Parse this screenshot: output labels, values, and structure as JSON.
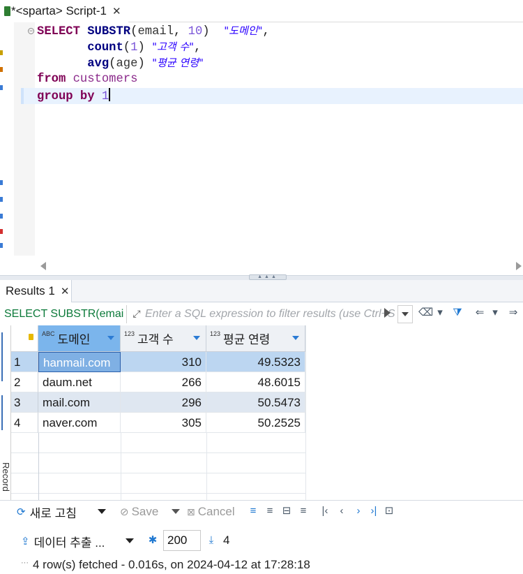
{
  "editor": {
    "tab_label": "*<sparta> Script-1",
    "tab_close": "✕",
    "sql": {
      "l1_kw": "SELECT",
      "l1_fn": "SUBSTR",
      "l1_open": "(",
      "l1_arg": "email",
      "l1_comma": ", ",
      "l1_num": "10",
      "l1_close": ")",
      "l1_alias": "\"도메인\"",
      "l1_end": ",",
      "l2_fn": "count",
      "l2_open": "(",
      "l2_num": "1",
      "l2_close": ")",
      "l2_alias": "\"고객 수\"",
      "l2_end": ",",
      "l3_fn": "avg",
      "l3_open": "(",
      "l3_arg": "age",
      "l3_close": ")",
      "l3_alias": "\"평균 연령\"",
      "l4_kw": "from",
      "l4_table": "customers",
      "l5_kw": "group by",
      "l5_num": "1"
    }
  },
  "results": {
    "tab_label": "Results 1",
    "tab_close": "✕",
    "filter_query": "SELECT SUBSTR(emai",
    "filter_placeholder": "Enter a SQL expression to filter results (use Ctrl+Space)",
    "columns": [
      {
        "type": "ABC",
        "name": "도메인"
      },
      {
        "type": "123",
        "name": "고객 수"
      },
      {
        "type": "123",
        "name": "평균 연령"
      }
    ],
    "rows": [
      {
        "num": "1",
        "domain": "hanmail.com",
        "count": "310",
        "avg": "49.5323"
      },
      {
        "num": "2",
        "domain": "daum.net",
        "count": "266",
        "avg": "48.6015"
      },
      {
        "num": "3",
        "domain": "mail.com",
        "count": "296",
        "avg": "50.5473"
      },
      {
        "num": "4",
        "domain": "naver.com",
        "count": "305",
        "avg": "50.2525"
      }
    ],
    "side_label": "Record"
  },
  "toolbar": {
    "refresh_label": "새로 고침",
    "save_label": "Save",
    "cancel_label": "Cancel",
    "export_label": "데이터 추출 ...",
    "fetch_size": "200",
    "fetch_count": "4"
  },
  "status": {
    "dots": "···",
    "message": "4 row(s) fetched - 0.016s, on 2024-04-12 at 17:28:18"
  },
  "colors": {
    "keyword": "#7f0055",
    "string": "#2a00ff",
    "number": "#7a55d8",
    "selected_header": "#7bb5ec",
    "selected_row": "#bcd6f1"
  }
}
